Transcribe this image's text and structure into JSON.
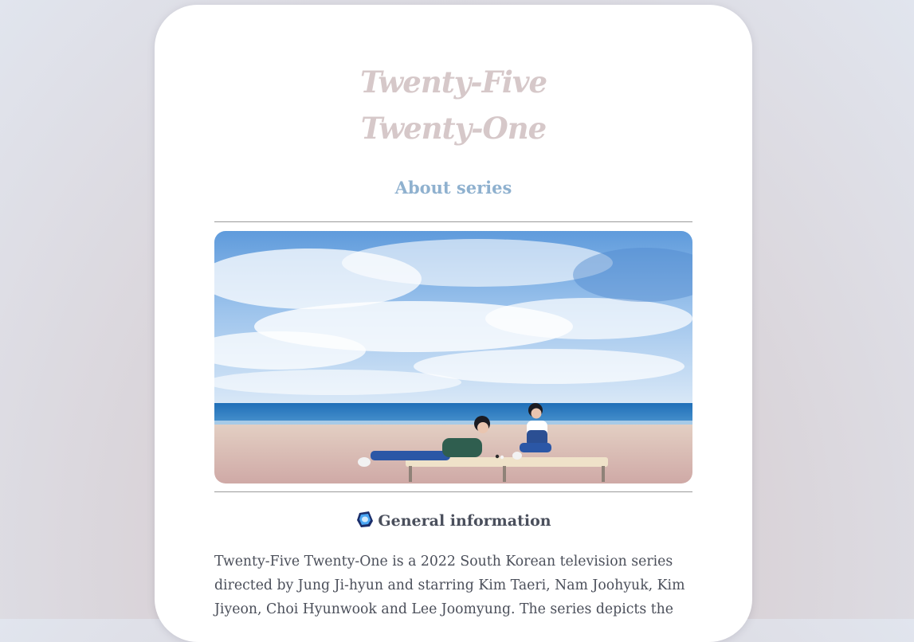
{
  "page": {
    "title_line1": "Twenty-Five",
    "title_line2": "Twenty-One",
    "subtitle": "About series",
    "section_heading": "General information",
    "paragraph": "Twenty-Five Twenty-One is a 2022 South Korean television series directed by Jung Ji-hyun and starring Kim Taeri, Nam Joohyuk, Kim Jiyeon, Choi Hyunwook and Lee Joomyung. The series depicts the"
  },
  "icons": {
    "section_icon": "blue-gem-icon"
  },
  "colors": {
    "title": "#d6c8c9",
    "subtitle": "#8fb1cf",
    "heading": "#4a4f5c",
    "text": "#4b4f5a",
    "card": "#ffffff"
  }
}
